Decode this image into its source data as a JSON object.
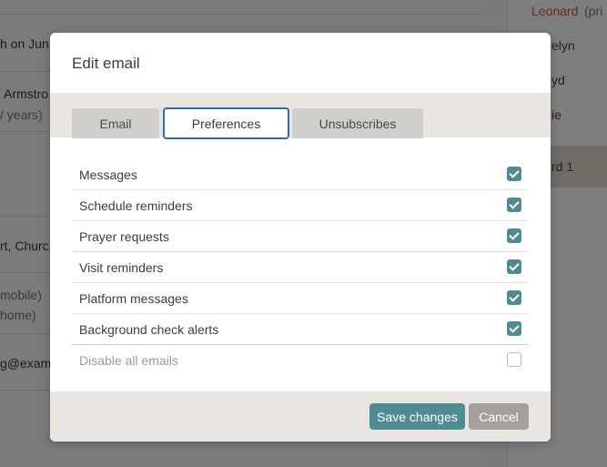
{
  "background": {
    "left_texts": [
      "h on Jun",
      "Armstro",
      "/ years)",
      "rt, Churc",
      "mobile)",
      "home)",
      "g@examp"
    ],
    "right_texts": [
      "Leonard",
      "(pri",
      "elyn",
      "yd",
      "ie",
      "rd 1"
    ]
  },
  "modal": {
    "title": "Edit email",
    "tabs": [
      {
        "label": "Email",
        "active": false
      },
      {
        "label": "Preferences",
        "active": true
      },
      {
        "label": "Unsubscribes",
        "active": false
      }
    ],
    "preferences": [
      {
        "label": "Messages",
        "checked": true
      },
      {
        "label": "Schedule reminders",
        "checked": true
      },
      {
        "label": "Prayer requests",
        "checked": true
      },
      {
        "label": "Visit reminders",
        "checked": true
      },
      {
        "label": "Platform messages",
        "checked": true
      },
      {
        "label": "Background check alerts",
        "checked": true
      },
      {
        "label": "Disable all emails",
        "checked": false
      }
    ],
    "buttons": {
      "save": "Save changes",
      "cancel": "Cancel"
    }
  },
  "colors": {
    "accent": "#4f8b92",
    "tab_active_border": "#2f6ea8",
    "cancel": "#a5a099",
    "band": "#e9e6e2"
  }
}
